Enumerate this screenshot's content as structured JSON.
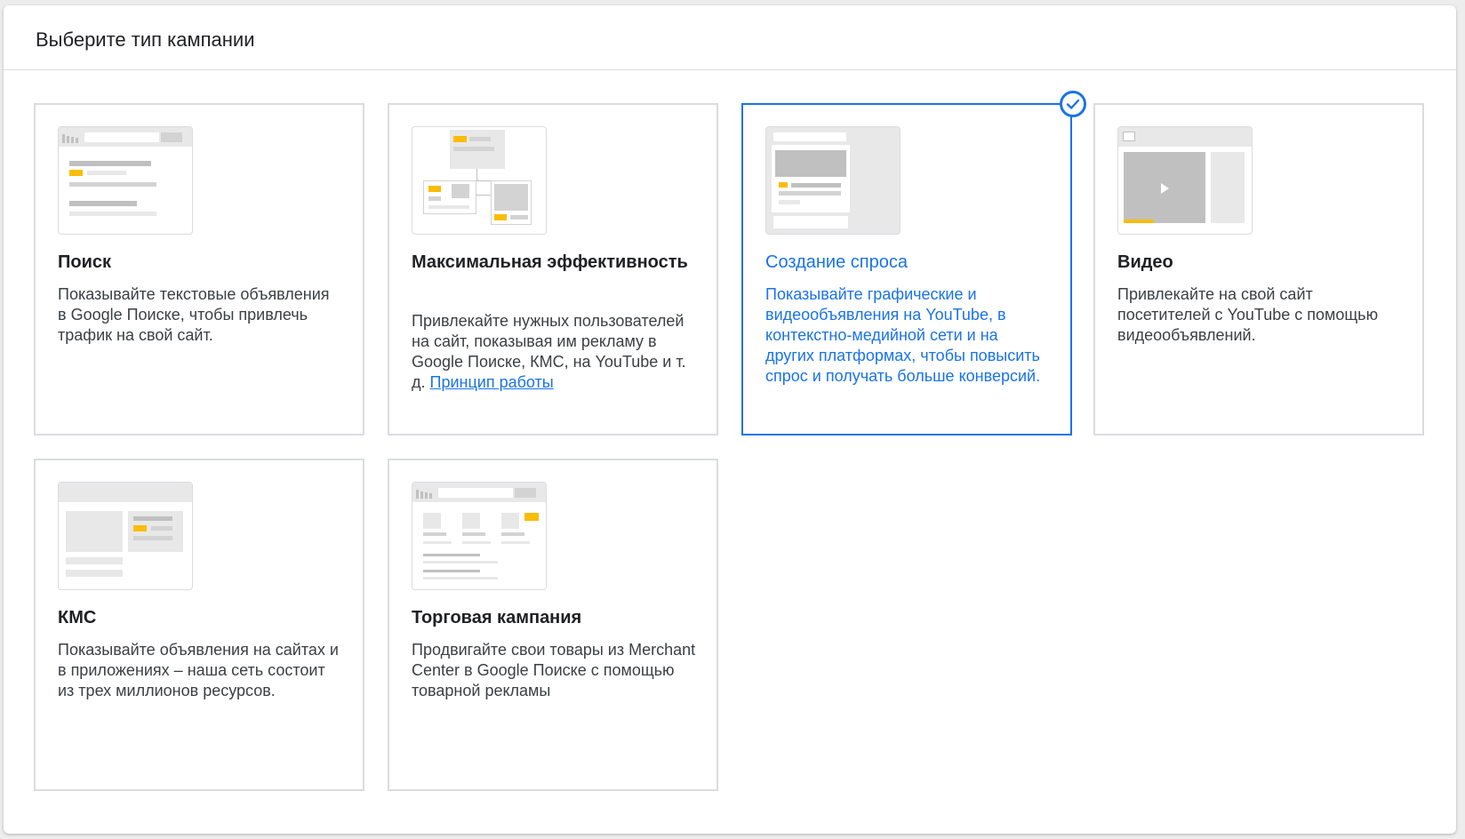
{
  "header": {
    "title": "Выберите тип кампании"
  },
  "cards": [
    {
      "title": "Поиск",
      "description": "Показывайте текстовые объявления в Google Поиске, чтобы привлечь трафик на свой сайт.",
      "icon": "search-campaign-illustration"
    },
    {
      "title": "Максимальная эффективность",
      "description": "Привлекайте нужных пользователей на сайт, показывая им рекламу в Google Поиске, КМС, на YouTube и т. д.",
      "link": "Принцип работы",
      "icon": "performance-max-illustration"
    },
    {
      "title": "Создание спроса",
      "description": "Показывайте графические и видеообъявления на YouTube, в контекстно-медийной сети и на других платформах, чтобы повысить спрос и получать больше конверсий.",
      "selected": true,
      "icon": "demand-gen-illustration"
    },
    {
      "title": "Видео",
      "description": "Привлекайте на свой сайт посетителей с YouTube с помощью видеообъявлений.",
      "icon": "video-campaign-illustration"
    },
    {
      "title": "КМС",
      "description": "Показывайте объявления на сайтах и в приложениях – наша сеть состоит из трех миллионов ресурсов.",
      "icon": "display-campaign-illustration"
    },
    {
      "title": "Торговая кампания",
      "description": "Продвигайте свои товары из Merchant Center в Google Поиске с помощью товарной рекламы",
      "icon": "shopping-campaign-illustration"
    }
  ],
  "colors": {
    "accent": "#1a73e8",
    "highlight": "#fbbc04",
    "border": "#dadce0",
    "text": "#202124"
  }
}
